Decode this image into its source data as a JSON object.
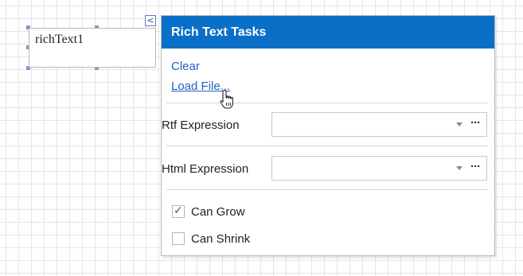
{
  "designer": {
    "control_name": "richText1",
    "smart_tag_glyph": "<"
  },
  "panel": {
    "title": "Rich Text Tasks",
    "actions": {
      "clear": "Clear",
      "load_file": "Load File..."
    },
    "properties": {
      "rtf_expression": {
        "label": "Rtf Expression",
        "value": ""
      },
      "html_expression": {
        "label": "Html Expression",
        "value": ""
      }
    },
    "ellipsis_label": "···",
    "options": {
      "can_grow": {
        "label": "Can Grow",
        "checked": true,
        "check_glyph": "✓"
      },
      "can_shrink": {
        "label": "Can Shrink",
        "checked": false
      }
    }
  },
  "icons": {
    "cursor": "hand-pointer-icon",
    "dropdown": "chevron-down-icon",
    "smart_tag": "chevron-left-icon"
  },
  "colors": {
    "header": "#0a6fc6",
    "link": "#1c64c0",
    "selection_handle": "#7a9cc7"
  }
}
